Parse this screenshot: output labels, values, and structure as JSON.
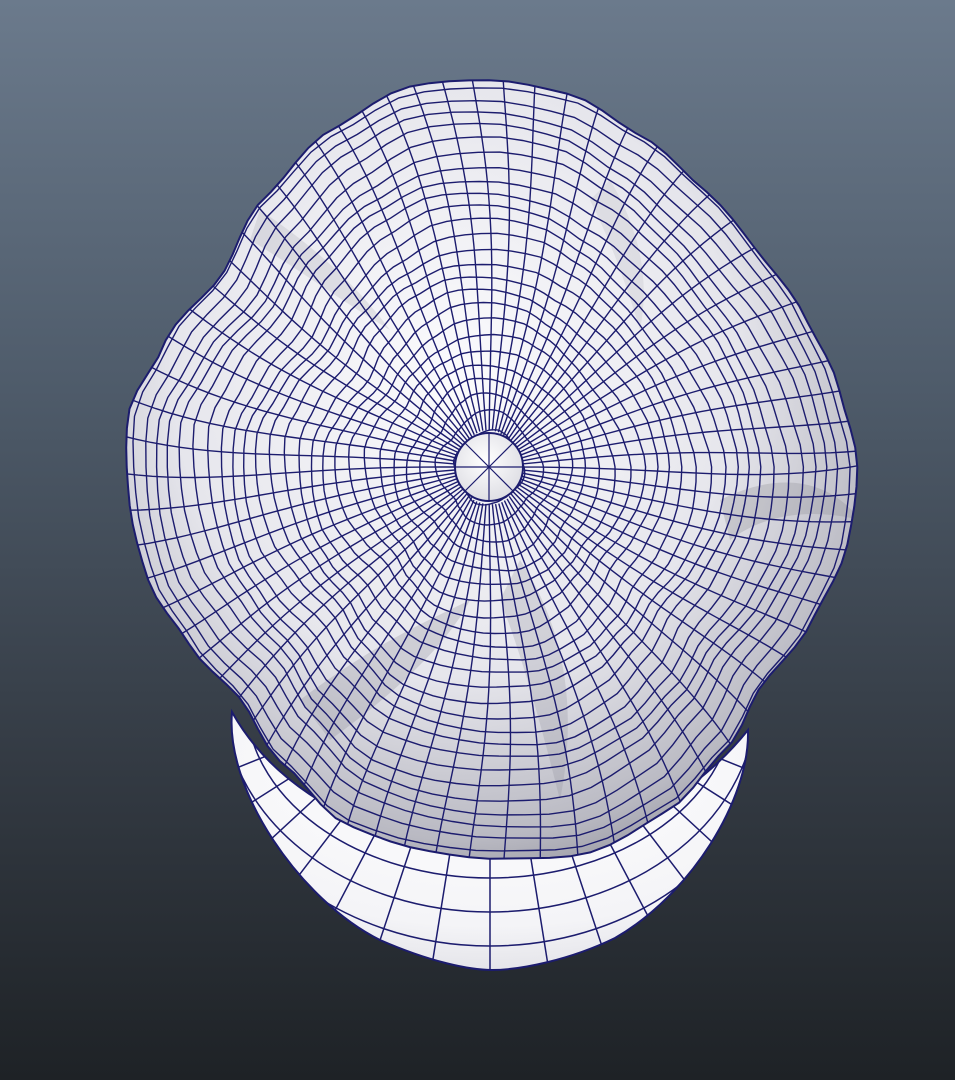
{
  "viewport": {
    "view": "top",
    "background_gradient": [
      "#6b7a8c",
      "#4f5c6b",
      "#343b44",
      "#1e2226"
    ],
    "shading": "smooth-shaded-with-wireframe"
  },
  "model": {
    "object": "newsboy-cap-mesh",
    "wire_color": "#1c1c6e",
    "surface_color": "#e9e9ee",
    "shadow_color": "#8d8d96",
    "crown_rings": 26,
    "crown_spokes": 72,
    "brim_rings": 5,
    "brim_spokes": 14,
    "button_spokes": 8
  }
}
